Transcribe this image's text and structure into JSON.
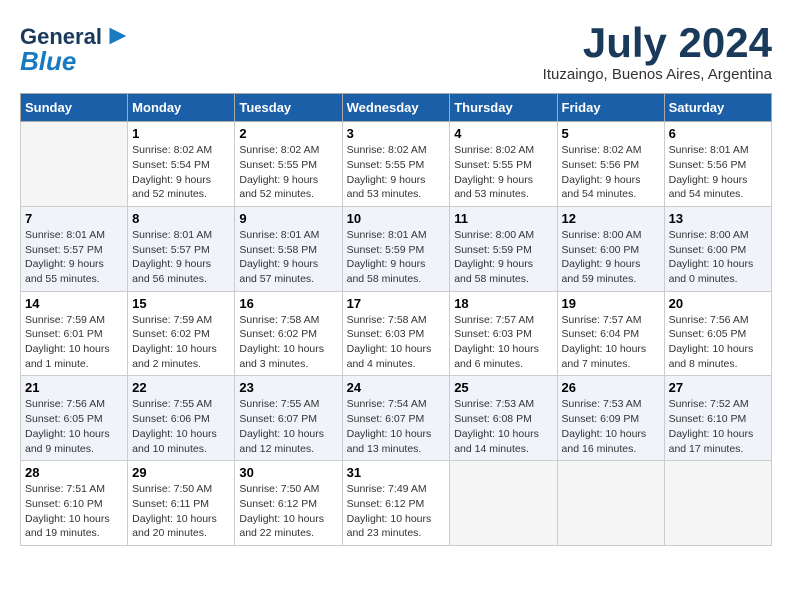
{
  "logo": {
    "line1": "General",
    "line2": "Blue",
    "bird_symbol": "▶"
  },
  "title": "July 2024",
  "location": "Ituzaingo, Buenos Aires, Argentina",
  "headers": [
    "Sunday",
    "Monday",
    "Tuesday",
    "Wednesday",
    "Thursday",
    "Friday",
    "Saturday"
  ],
  "weeks": [
    [
      {
        "day": "",
        "info": ""
      },
      {
        "day": "1",
        "info": "Sunrise: 8:02 AM\nSunset: 5:54 PM\nDaylight: 9 hours\nand 52 minutes."
      },
      {
        "day": "2",
        "info": "Sunrise: 8:02 AM\nSunset: 5:55 PM\nDaylight: 9 hours\nand 52 minutes."
      },
      {
        "day": "3",
        "info": "Sunrise: 8:02 AM\nSunset: 5:55 PM\nDaylight: 9 hours\nand 53 minutes."
      },
      {
        "day": "4",
        "info": "Sunrise: 8:02 AM\nSunset: 5:55 PM\nDaylight: 9 hours\nand 53 minutes."
      },
      {
        "day": "5",
        "info": "Sunrise: 8:02 AM\nSunset: 5:56 PM\nDaylight: 9 hours\nand 54 minutes."
      },
      {
        "day": "6",
        "info": "Sunrise: 8:01 AM\nSunset: 5:56 PM\nDaylight: 9 hours\nand 54 minutes."
      }
    ],
    [
      {
        "day": "7",
        "info": "Sunrise: 8:01 AM\nSunset: 5:57 PM\nDaylight: 9 hours\nand 55 minutes."
      },
      {
        "day": "8",
        "info": "Sunrise: 8:01 AM\nSunset: 5:57 PM\nDaylight: 9 hours\nand 56 minutes."
      },
      {
        "day": "9",
        "info": "Sunrise: 8:01 AM\nSunset: 5:58 PM\nDaylight: 9 hours\nand 57 minutes."
      },
      {
        "day": "10",
        "info": "Sunrise: 8:01 AM\nSunset: 5:59 PM\nDaylight: 9 hours\nand 58 minutes."
      },
      {
        "day": "11",
        "info": "Sunrise: 8:00 AM\nSunset: 5:59 PM\nDaylight: 9 hours\nand 58 minutes."
      },
      {
        "day": "12",
        "info": "Sunrise: 8:00 AM\nSunset: 6:00 PM\nDaylight: 9 hours\nand 59 minutes."
      },
      {
        "day": "13",
        "info": "Sunrise: 8:00 AM\nSunset: 6:00 PM\nDaylight: 10 hours\nand 0 minutes."
      }
    ],
    [
      {
        "day": "14",
        "info": "Sunrise: 7:59 AM\nSunset: 6:01 PM\nDaylight: 10 hours\nand 1 minute."
      },
      {
        "day": "15",
        "info": "Sunrise: 7:59 AM\nSunset: 6:02 PM\nDaylight: 10 hours\nand 2 minutes."
      },
      {
        "day": "16",
        "info": "Sunrise: 7:58 AM\nSunset: 6:02 PM\nDaylight: 10 hours\nand 3 minutes."
      },
      {
        "day": "17",
        "info": "Sunrise: 7:58 AM\nSunset: 6:03 PM\nDaylight: 10 hours\nand 4 minutes."
      },
      {
        "day": "18",
        "info": "Sunrise: 7:57 AM\nSunset: 6:03 PM\nDaylight: 10 hours\nand 6 minutes."
      },
      {
        "day": "19",
        "info": "Sunrise: 7:57 AM\nSunset: 6:04 PM\nDaylight: 10 hours\nand 7 minutes."
      },
      {
        "day": "20",
        "info": "Sunrise: 7:56 AM\nSunset: 6:05 PM\nDaylight: 10 hours\nand 8 minutes."
      }
    ],
    [
      {
        "day": "21",
        "info": "Sunrise: 7:56 AM\nSunset: 6:05 PM\nDaylight: 10 hours\nand 9 minutes."
      },
      {
        "day": "22",
        "info": "Sunrise: 7:55 AM\nSunset: 6:06 PM\nDaylight: 10 hours\nand 10 minutes."
      },
      {
        "day": "23",
        "info": "Sunrise: 7:55 AM\nSunset: 6:07 PM\nDaylight: 10 hours\nand 12 minutes."
      },
      {
        "day": "24",
        "info": "Sunrise: 7:54 AM\nSunset: 6:07 PM\nDaylight: 10 hours\nand 13 minutes."
      },
      {
        "day": "25",
        "info": "Sunrise: 7:53 AM\nSunset: 6:08 PM\nDaylight: 10 hours\nand 14 minutes."
      },
      {
        "day": "26",
        "info": "Sunrise: 7:53 AM\nSunset: 6:09 PM\nDaylight: 10 hours\nand 16 minutes."
      },
      {
        "day": "27",
        "info": "Sunrise: 7:52 AM\nSunset: 6:10 PM\nDaylight: 10 hours\nand 17 minutes."
      }
    ],
    [
      {
        "day": "28",
        "info": "Sunrise: 7:51 AM\nSunset: 6:10 PM\nDaylight: 10 hours\nand 19 minutes."
      },
      {
        "day": "29",
        "info": "Sunrise: 7:50 AM\nSunset: 6:11 PM\nDaylight: 10 hours\nand 20 minutes."
      },
      {
        "day": "30",
        "info": "Sunrise: 7:50 AM\nSunset: 6:12 PM\nDaylight: 10 hours\nand 22 minutes."
      },
      {
        "day": "31",
        "info": "Sunrise: 7:49 AM\nSunset: 6:12 PM\nDaylight: 10 hours\nand 23 minutes."
      },
      {
        "day": "",
        "info": ""
      },
      {
        "day": "",
        "info": ""
      },
      {
        "day": "",
        "info": ""
      }
    ]
  ]
}
